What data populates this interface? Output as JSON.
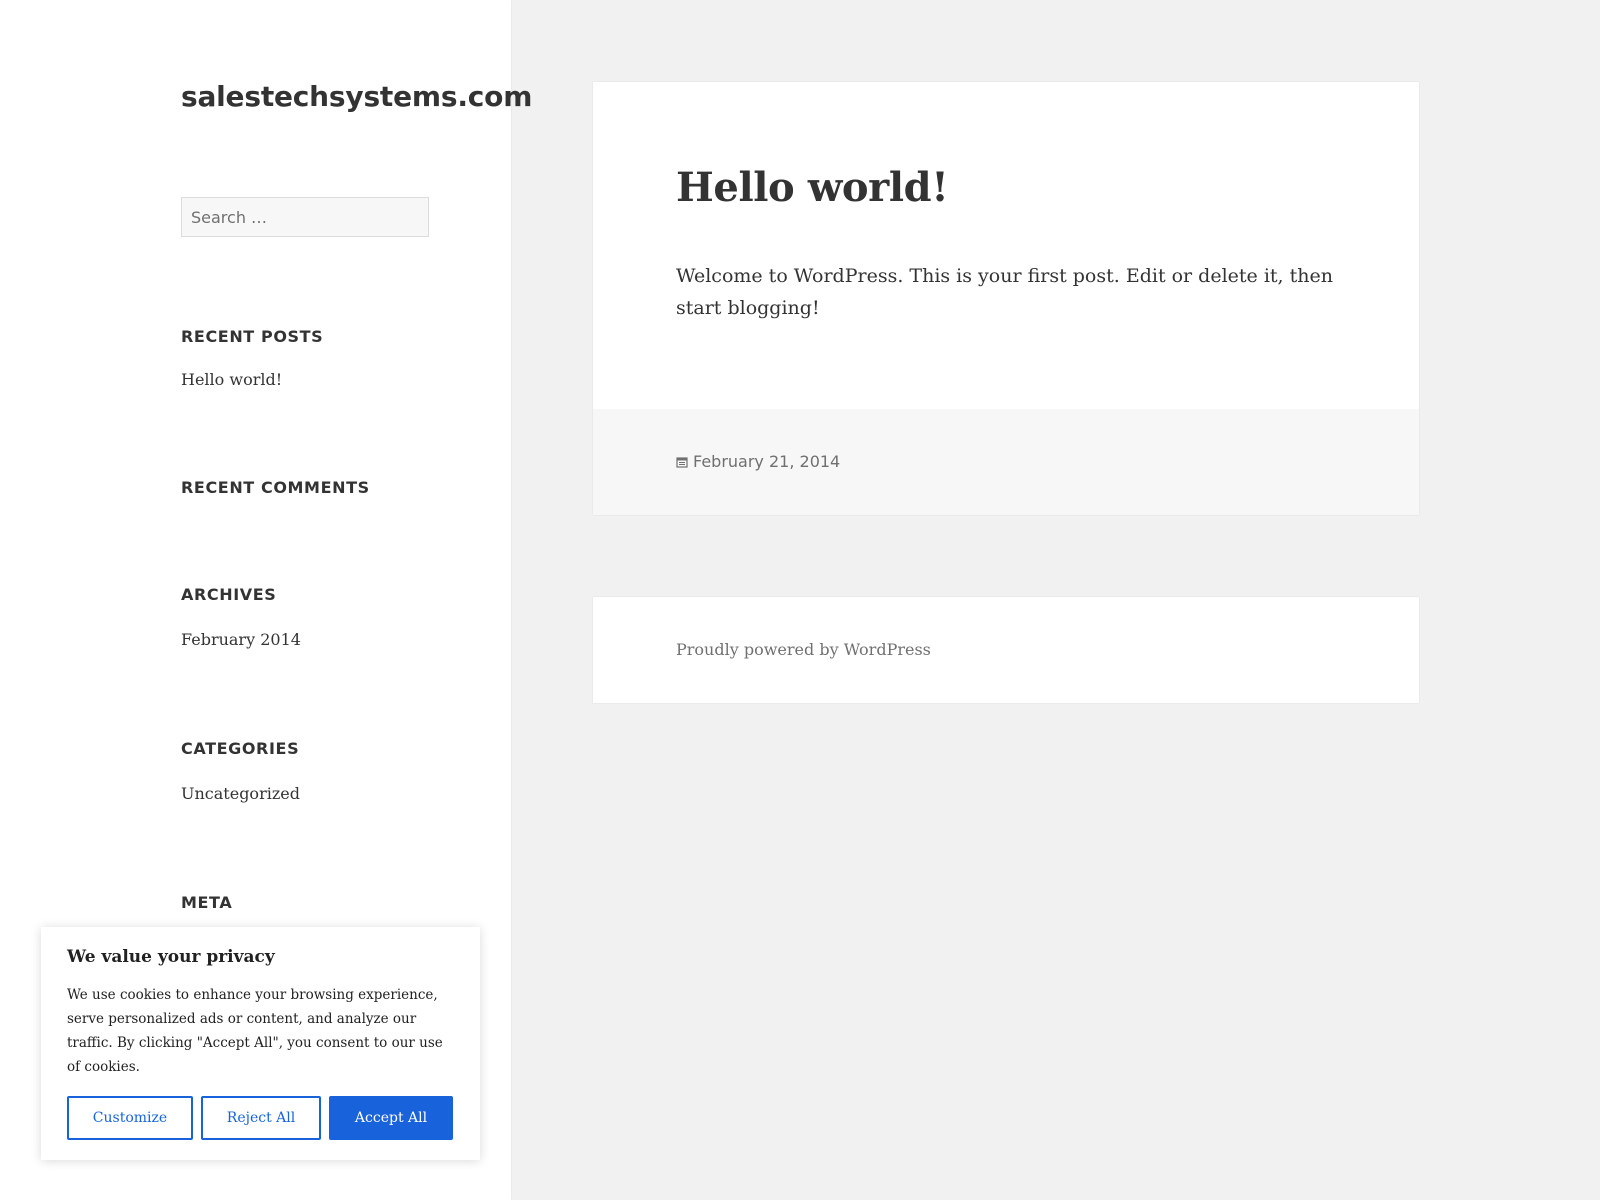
{
  "site": {
    "title": "salestechsystems.com"
  },
  "sidebar": {
    "search_placeholder": "Search …",
    "widgets": {
      "recent_posts": {
        "title": "Recent Posts",
        "items": [
          "Hello world!"
        ]
      },
      "recent_comments": {
        "title": "Recent Comments"
      },
      "archives": {
        "title": "Archives",
        "items": [
          "February 2014"
        ]
      },
      "categories": {
        "title": "Categories",
        "items": [
          "Uncategorized"
        ]
      },
      "meta": {
        "title": "Meta"
      }
    }
  },
  "post": {
    "title": "Hello world!",
    "body": "Welcome to WordPress. This is your first post. Edit or delete it, then start blogging!",
    "date": "February 21, 2014",
    "date_icon": "calendar-icon"
  },
  "footer": {
    "powered_by": "Proudly powered by WordPress"
  },
  "cookie_banner": {
    "title": "We value your privacy",
    "text": "We use cookies to enhance your browsing experience, serve personalized ads or content, and analyze our traffic. By clicking \"Accept All\", you consent to our use of cookies.",
    "customize_label": "Customize",
    "reject_label": "Reject All",
    "accept_label": "Accept All"
  },
  "colors": {
    "background": "#f1f1f1",
    "card": "#ffffff",
    "text": "#333333",
    "muted": "#707070",
    "accent": "#1863dc"
  }
}
